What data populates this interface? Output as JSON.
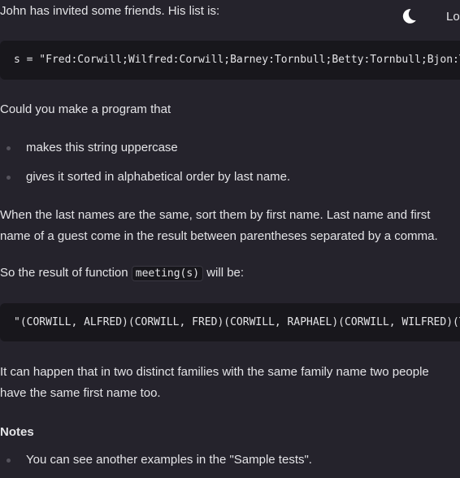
{
  "header": {
    "intro": "John has invited some friends. His list is:",
    "login_label": "Lo"
  },
  "code_input": "s = \"Fred:Corwill;Wilfred:Corwill;Barney:Tornbull;Betty:Tornbull;Bjon:To",
  "ask": "Could you make a program that",
  "bullets": [
    "makes this string uppercase",
    "gives it sorted in alphabetical order by last name."
  ],
  "para_sort_line1": "When the last names are the same, sort them by first name. Last name and first",
  "para_sort_line2": "name of a guest come in the result between parentheses separated by a comma.",
  "result_prefix": "So the result of function ",
  "result_code": "meeting(s)",
  "result_suffix": " will be:",
  "code_output": "\"(CORWILL, ALFRED)(CORWILL, FRED)(CORWILL, RAPHAEL)(CORWILL, WILFRED)(TO",
  "para_same_line1": "It can happen that in two distinct families with the same family name two people",
  "para_same_line2": "have the same first name too.",
  "notes_heading": "Notes",
  "notes_bullets": [
    "You can see another examples in the \"Sample tests\"."
  ],
  "icons": {
    "theme_toggle": "moon-icon"
  }
}
